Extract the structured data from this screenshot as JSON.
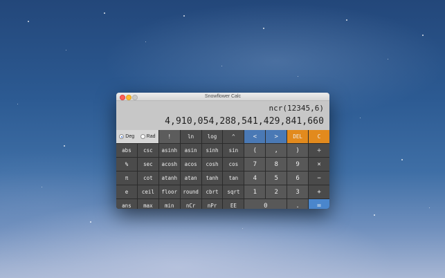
{
  "window": {
    "title": "Snowflower Calc"
  },
  "display": {
    "expression": "ncr(12345,6)",
    "result": "4,910,054,288,541,429,841,660"
  },
  "angle_mode": {
    "deg_label": "Deg",
    "rad_label": "Rad",
    "selected": "Deg"
  },
  "keys": {
    "row1": [
      "!",
      "ln",
      "log",
      "^",
      "<",
      ">",
      "DEL",
      "C"
    ],
    "row2": [
      "abs",
      "csc",
      "asinh",
      "asin",
      "sinh",
      "sin",
      "(",
      ",",
      ")",
      "÷"
    ],
    "row3": [
      "%",
      "sec",
      "acosh",
      "acos",
      "cosh",
      "cos",
      "7",
      "8",
      "9",
      "×"
    ],
    "row4": [
      "π",
      "cot",
      "atanh",
      "atan",
      "tanh",
      "tan",
      "4",
      "5",
      "6",
      "−"
    ],
    "row5": [
      "e",
      "ceil",
      "floor",
      "round",
      "cbrt",
      "sqrt",
      "1",
      "2",
      "3",
      "+"
    ],
    "row6": [
      "ans",
      "max",
      "min",
      "nCr",
      "nPr",
      "EE",
      "0",
      ".",
      "="
    ]
  }
}
